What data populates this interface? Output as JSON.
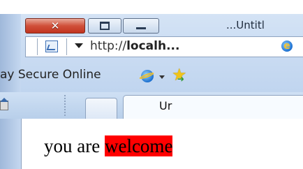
{
  "top_strip": {
    "mark": "ۛ"
  },
  "window": {
    "title": "...Untitl"
  },
  "address_bar": {
    "url_prefix": "http://",
    "url_host": "localh...",
    "ie_glyph": "e"
  },
  "favorites_bar": {
    "label": "ay Secure Online"
  },
  "tabs": {
    "active_label": "Ur"
  },
  "content": {
    "text_before": "you are ",
    "highlighted": "welcome",
    "highlight_color": "#ff0000"
  }
}
